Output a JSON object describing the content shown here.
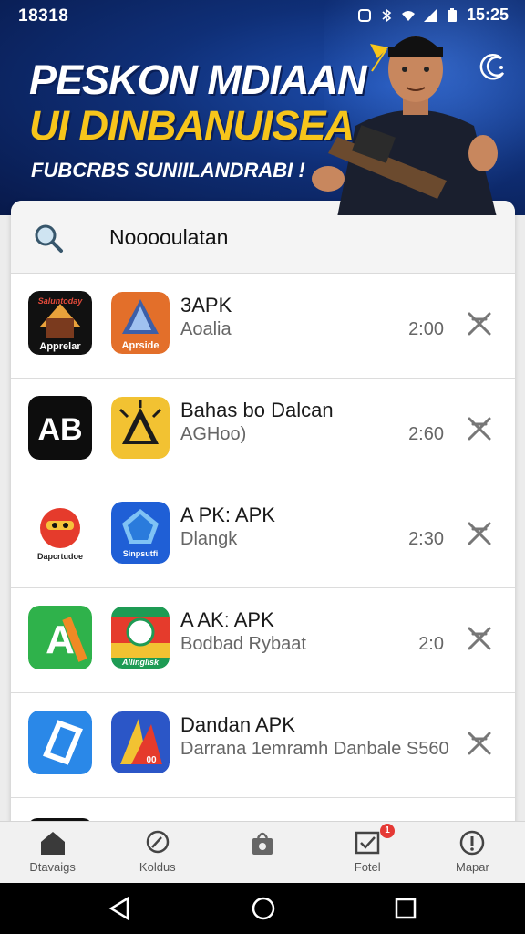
{
  "status": {
    "time": "18318",
    "clock": "15:25"
  },
  "hero": {
    "headline_1": "PESKON MDIAAN",
    "headline_2": "UI DINBANUISEA",
    "tagline": "FUBCRBS SUNIILANDRABI !"
  },
  "search": {
    "value": "Nooooulatan"
  },
  "items": [
    {
      "icon_a_text": "Apprelar",
      "icon_a_text2": "Saluntoday",
      "icon_b_text": "Aprside",
      "title": "3APK",
      "subtitle": "Aoalia",
      "time": "2:00"
    },
    {
      "icon_a_text": "AB",
      "icon_b_text": "",
      "title": "Bahas bo Dalcan",
      "subtitle": "AGHoo)",
      "time": "2:60"
    },
    {
      "icon_a_text": "Dapcrtudoe",
      "icon_b_text": "Sinpsutfi",
      "title": "A PK: APK",
      "subtitle": "Dlangk",
      "time": "2:30"
    },
    {
      "icon_a_text": "A",
      "icon_b_text": "Allinglisk",
      "title": "A AKː APK",
      "subtitle": "Bodbad Rybaat",
      "time": "2:0"
    },
    {
      "icon_a_text": "",
      "icon_b_text": "00",
      "title": "Dandan APK",
      "subtitle": "Darrana 1emramh Danbale S560",
      "time": ""
    }
  ],
  "nav": [
    {
      "label": "Dtavaigs",
      "icon": "home-icon"
    },
    {
      "label": "Koldus",
      "icon": "search-icon"
    },
    {
      "label": "",
      "icon": "bag-icon"
    },
    {
      "label": "Fotel",
      "icon": "checkbox-icon",
      "badge": "1"
    },
    {
      "label": "Mapar",
      "icon": "info-icon"
    }
  ],
  "colors": {
    "accent_yellow": "#f7c51b",
    "hero_blue": "#0f2f77",
    "badge_red": "#e53935"
  }
}
